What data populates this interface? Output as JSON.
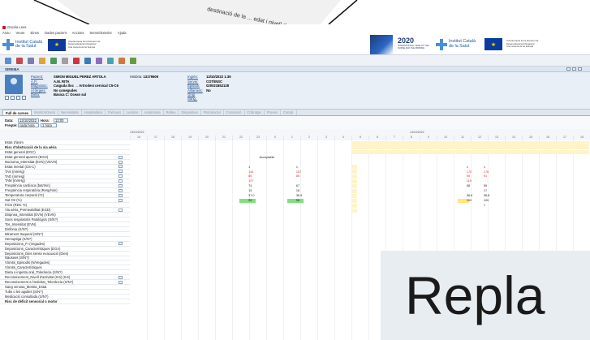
{
  "window": {
    "title": "Gacela Lees"
  },
  "menu": [
    "Arxiu",
    "Veure",
    "Eines",
    "Dades pacient",
    "Accions",
    "Servei/Exterior",
    "Ajuda"
  ],
  "banner": {
    "logo_text": "Institut Català de la Salut",
    "eu_text": "Unió Europea Fons Europeu de Desenvolupament Regional Una manera de fer Europa",
    "year": "2020",
    "year_sub": "INTERNATIONAL YEAR OF THE NURSE AND THE MIDWIFE"
  },
  "section": {
    "title": "SIREMA"
  },
  "patient": {
    "fields": [
      {
        "label": "Pacient:",
        "value": "SIMON MIGUEL PEREZ ARTOLA"
      },
      {
        "label": "A.P.:",
        "value": "A.M. RITA"
      },
      {
        "label": "Diagnòstic:",
        "value": "Caiguda lloc → Artrodesi cervical C5-C6"
      },
      {
        "label": "Al·lèrgies:",
        "value": "No conegudes"
      },
      {
        "label": "Dieta:",
        "value": "Bàsica C: Ocean sal"
      }
    ],
    "history_label": "Història:",
    "history_value": "13179609",
    "fields2": [
      {
        "label": "Ingrés:",
        "value": "13/10/2022 1:39"
      },
      {
        "label": "Servei:",
        "value": "COT/INSC"
      },
      {
        "label": "Episodi:",
        "value": "020021852128"
      },
      {
        "label": "Aïllament:",
        "value": "No"
      },
      {
        "label": "Grup Sang.:",
        "value": ""
      }
    ]
  },
  "tabs": [
    "Full de curses",
    "Monitorització",
    "Necessitats",
    "Hospitalària",
    "Fàrmacs",
    "Lesions",
    "Autonomia",
    "Relleu",
    "Dispositius",
    "Psicosocial",
    "Contenció",
    "Cribratge",
    "Proves",
    "Compl."
  ],
  "controls": {
    "date_label": "Data:",
    "date_value": "13/10/2022",
    "hour_label": "Hora:",
    "hour_value": "13:00",
    "freq_label": "Freqüè:",
    "freq_value": "cada hora",
    "freq_value2": "1 hora"
  },
  "grid": {
    "date1": "13/10/2022",
    "date2": "14/10/2022",
    "hours": [
      "16",
      "17",
      "18",
      "19",
      "20",
      "21",
      "22",
      "23",
      "0",
      "1",
      "2",
      "3",
      "4",
      "5",
      "6",
      "7",
      "8",
      "9",
      "10",
      "11",
      "12",
      "13",
      "14",
      "15",
      "16",
      "17",
      "18"
    ],
    "rows": [
      {
        "label": "Estat d'ànim",
        "bold": false,
        "chk": false
      },
      {
        "label": "Risc d'obstrucció de la via aèria",
        "bold": true,
        "chk": false
      },
      {
        "label": "Estat general (EGC)",
        "bold": false,
        "chk": false
      },
      {
        "label": "Estat general aparent (EGO)",
        "bold": false,
        "chk": true
      },
      {
        "label": "Nocturna_Intensitat (EVN) (VEVN)",
        "bold": false,
        "chk": true
      },
      {
        "label": "Estat mental (GS-C)",
        "bold": false,
        "chk": true
      },
      {
        "label": "TAS (mmHg)",
        "bold": false,
        "chk": true
      },
      {
        "label": "TAD (mmHg)",
        "bold": false,
        "chk": true
      },
      {
        "label": "TAM (mmHg)",
        "bold": false,
        "chk": true
      },
      {
        "label": "Freqüència cardíaca (bat/min)",
        "bold": false,
        "chk": true
      },
      {
        "label": "Freqüència respiratòria (Resp/min)",
        "bold": false,
        "chk": true
      },
      {
        "label": "Temperatura corporal (ºC)",
        "bold": false,
        "chk": true
      },
      {
        "label": "Sat O2 (%)",
        "bold": false,
        "chk": true
      },
      {
        "label": "FiO2 (RDC %)",
        "bold": false,
        "chk": false
      },
      {
        "label": "Via aèria_Permeabilitat (EGD)",
        "bold": false,
        "chk": true
      },
      {
        "label": "Dispnea_Intensitat (EVN) (VEVN)",
        "bold": false,
        "chk": false
      },
      {
        "label": "Sons respiratoris Patològics (S/N?)",
        "bold": false,
        "chk": false
      },
      {
        "label": "Tos_Intensitat (EVN)",
        "bold": false,
        "chk": false
      },
      {
        "label": "Disfonia (S/N?)",
        "bold": false,
        "chk": false
      },
      {
        "label": "Mirament traqueal (S/N?)",
        "bold": false,
        "chk": false
      },
      {
        "label": "Hemoptiga (S/N?)",
        "bold": false,
        "chk": false
      },
      {
        "label": "Deposicions_Fr (Vegades)",
        "bold": false,
        "chk": true
      },
      {
        "label": "Deposicions_Característiques (EGA)",
        "bold": false,
        "chk": false
      },
      {
        "label": "Deposicions_Dies sense evacuació (Dies)",
        "bold": false,
        "chk": false
      },
      {
        "label": "Nàusees (S/N?)",
        "bold": false,
        "chk": false
      },
      {
        "label": "Vòmits_Episodis (N/Vegades)",
        "bold": false,
        "chk": false
      },
      {
        "label": "Vòmits_Característiques",
        "bold": false,
        "chk": false
      },
      {
        "label": "Dieta o ingesta oral_Tolerància (S/N?)",
        "bold": false,
        "chk": false
      },
      {
        "label": "Reconeixement_Nivell d'activitat (0-6) (0-6)",
        "bold": false,
        "chk": true
      },
      {
        "label": "Reconeixement a l'activitat_Tolerància (S/N?)",
        "bold": false,
        "chk": true
      },
      {
        "label": "Sang venosa_Mostra_Estat",
        "bold": false,
        "chk": false
      },
      {
        "label": "Tubs o les agulles (S/N?)",
        "bold": false,
        "chk": false
      },
      {
        "label": "Medicació consultada (S/N?)",
        "bold": false,
        "chk": false
      },
      {
        "label": "Risc de dèficit sensorial o motor",
        "bold": true,
        "chk": false
      }
    ],
    "acceptable": "Acceptable",
    "col1": {
      "tas": "144",
      "tad": "85",
      "tam": "107",
      "fc": "74",
      "fr": "15",
      "temp": "37,0",
      "sat": "95",
      "mental": "1"
    },
    "col2": {
      "tas": "157",
      "tad": "85",
      "fc": "67",
      "fr": "18",
      "temp": "36,9",
      "sat": "98",
      "mental": "1"
    },
    "col3": {
      "tas": "170",
      "tad": "90",
      "tam": "119",
      "fc": "58",
      "temp": "36,6",
      "sat": "100",
      "mental": "1"
    },
    "col4": {
      "tas": "176",
      "tad": "91",
      "fc": "59",
      "fr": "17",
      "temp": "36,8",
      "sat": "100",
      "mental": "1",
      "flag": "2"
    }
  },
  "overlay": {
    "text": "Repla"
  },
  "photo_text": "destinació de la ... edat i nivell d..."
}
